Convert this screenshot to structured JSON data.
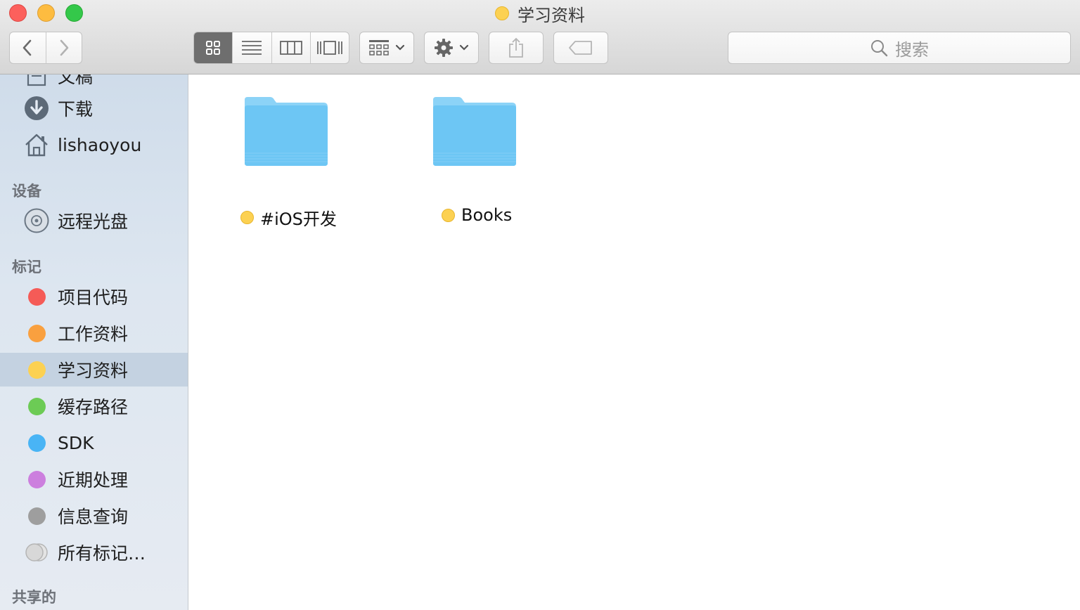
{
  "window": {
    "title": "学习资料",
    "title_tag_color": "#FCD152"
  },
  "toolbar": {
    "back_icon": "chevron-left-icon",
    "forward_icon": "chevron-right-icon",
    "view_modes": [
      "icon-view-icon",
      "list-view-icon",
      "column-view-icon",
      "cover-flow-icon"
    ],
    "arrange_icon": "arrange-grid-icon",
    "action_icon": "gear-icon",
    "share_icon": "share-icon",
    "tag_icon": "tag-icon"
  },
  "search": {
    "placeholder": "搜索"
  },
  "sidebar": {
    "favorites": [
      {
        "label": "文稿",
        "icon": "document-icon"
      },
      {
        "label": "下载",
        "icon": "download-icon"
      },
      {
        "label": "lishaoyou",
        "icon": "home-icon"
      }
    ],
    "devices_header": "设备",
    "devices": [
      {
        "label": "远程光盘",
        "icon": "disc-icon"
      }
    ],
    "tags_header": "标记",
    "tags": [
      {
        "label": "项目代码",
        "color": "#F55B57"
      },
      {
        "label": "工作资料",
        "color": "#F9A03F"
      },
      {
        "label": "学习资料",
        "color": "#FCD152",
        "selected": true
      },
      {
        "label": "缓存路径",
        "color": "#6CCB55"
      },
      {
        "label": "SDK",
        "color": "#49B4F5"
      },
      {
        "label": "近期处理",
        "color": "#CC7FDE"
      },
      {
        "label": "信息查询",
        "color": "#9E9E9E"
      },
      {
        "label": "所有标记…",
        "color": "#D8D8D8"
      }
    ],
    "shared_header": "共享的"
  },
  "main": {
    "items": [
      {
        "name": "#iOS开发",
        "type": "folder",
        "tag_color": "#FCD152"
      },
      {
        "name": "Books",
        "type": "folder",
        "tag_color": "#FCD152"
      }
    ]
  }
}
